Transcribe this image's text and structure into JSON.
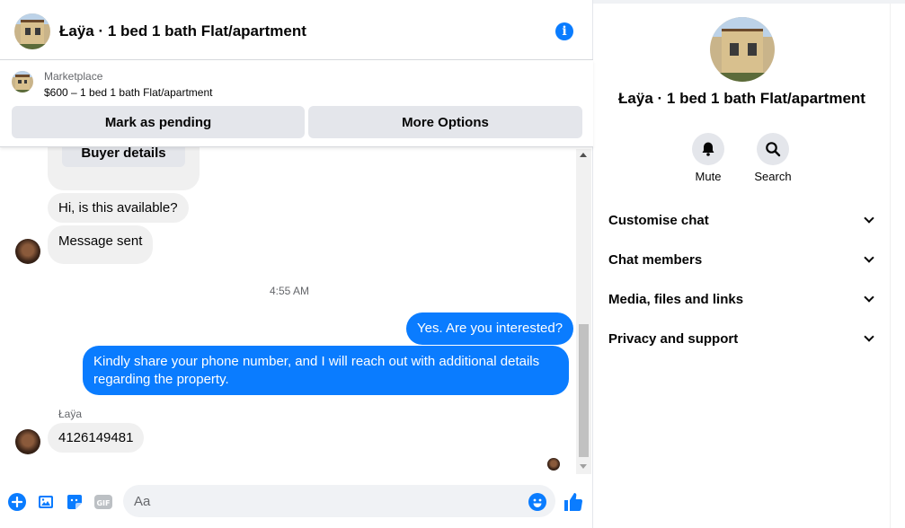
{
  "header": {
    "title": "Łaÿa · 1 bed 1 bath Flat/apartment"
  },
  "marketplace": {
    "label": "Marketplace",
    "listing": "$600 – 1 bed 1 bath Flat/apartment",
    "mark_pending": "Mark as pending",
    "more_options": "More Options"
  },
  "messages": {
    "buyer_details": "Buyer details",
    "msg1": "Hi, is this available?",
    "msg2": "Message sent",
    "timestamp": "4:55 AM",
    "out1": "Yes. Are you interested?",
    "out2": "Kindly share your phone number, and I will reach out with additional details regarding the property.",
    "sender": "Łaÿa",
    "msg3": "4126149481"
  },
  "composer": {
    "placeholder": "Aa"
  },
  "sidebar": {
    "title": "Łaÿa · 1 bed 1 bath Flat/apartment",
    "mute": "Mute",
    "search": "Search",
    "rows": [
      "Customise chat",
      "Chat members",
      "Media, files and links",
      "Privacy and support"
    ]
  },
  "colors": {
    "accent": "#0a7cff",
    "bubble_in": "#f0f0f0"
  },
  "icons": [
    "info-icon",
    "bell-icon",
    "search-icon",
    "plus-icon",
    "image-icon",
    "sticker-icon",
    "gif-icon",
    "emoji-icon",
    "like-icon",
    "chevron-down-icon"
  ]
}
